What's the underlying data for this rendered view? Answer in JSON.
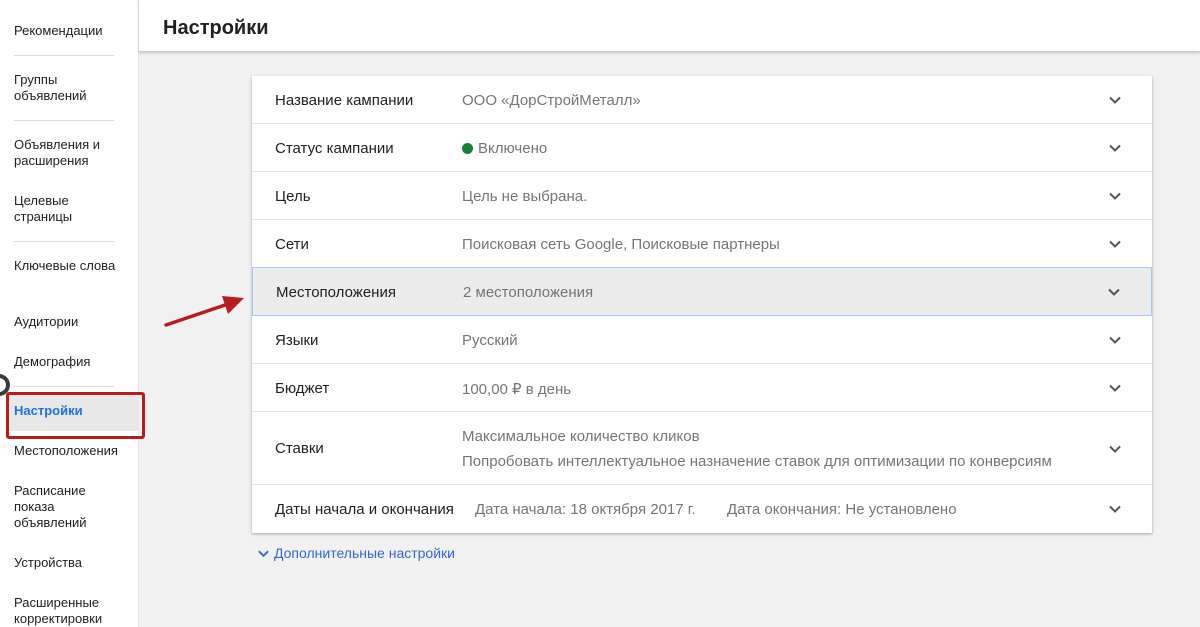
{
  "sidebar": {
    "items": [
      {
        "label": "Рекомендации"
      },
      {
        "label": "Группы объявлений"
      },
      {
        "label": "Объявления и расширения"
      },
      {
        "label": "Целевые страницы"
      },
      {
        "label": "Ключевые слова"
      },
      {
        "label": "Аудитории"
      },
      {
        "label": "Демография"
      },
      {
        "label": "Настройки",
        "active": true
      },
      {
        "label": "Местоположения"
      },
      {
        "label": "Расписание показа объявлений"
      },
      {
        "label": "Устройства"
      },
      {
        "label": "Расширенные корректировки"
      }
    ]
  },
  "header": {
    "title": "Настройки"
  },
  "settings": {
    "rows": [
      {
        "label": "Название кампании",
        "value": "ООО «ДорСтройМеталл»"
      },
      {
        "label": "Статус кампании",
        "value": "Включено"
      },
      {
        "label": "Цель",
        "value": "Цель не выбрана."
      },
      {
        "label": "Сети",
        "value": "Поисковая сеть Google, Поисковые партнеры"
      },
      {
        "label": "Местоположения",
        "value": "2 местоположения"
      },
      {
        "label": "Языки",
        "value": "Русский"
      },
      {
        "label": "Бюджет",
        "value": "100,00 ₽ в день"
      },
      {
        "label": "Ставки",
        "value": "Максимальное количество кликов",
        "link": "Попробовать интеллектуальное назначение ставок для оптимизации по конверсиям"
      },
      {
        "label": "Даты начала и окончания",
        "start": "Дата начала: 18 октября 2017 г.",
        "end": "Дата окончания: Не установлено"
      }
    ],
    "more": "Дополнительные настройки"
  },
  "colors": {
    "accent": "#3367d6",
    "status_on": "#188038",
    "annotation": "#b81c1c"
  }
}
